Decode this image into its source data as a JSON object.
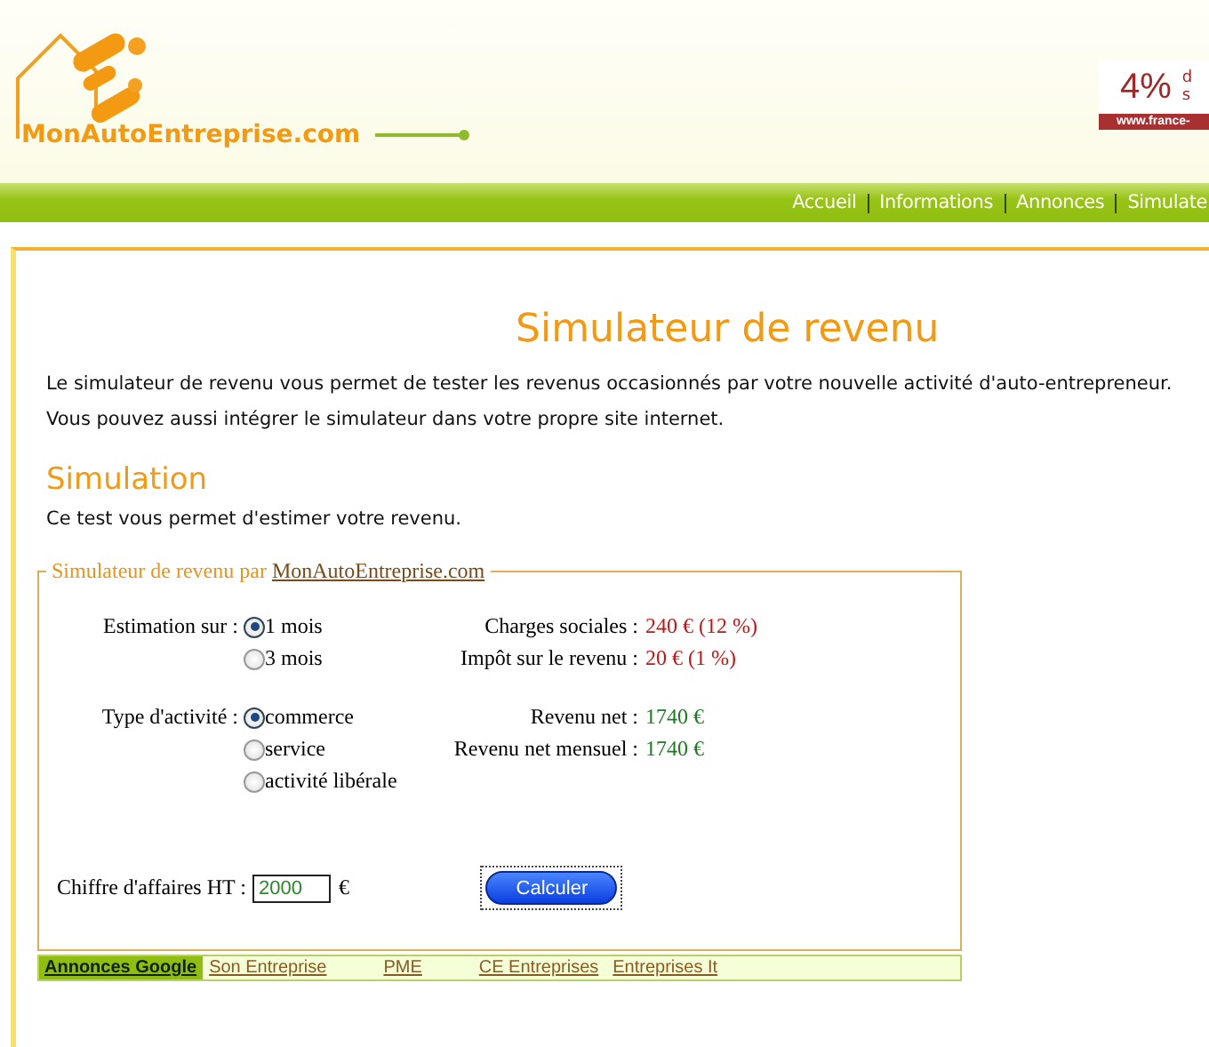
{
  "header": {
    "logo_text": "MonAutoEntreprise.com",
    "ad": {
      "percent": "4%",
      "line_1": "d",
      "line_2": "s",
      "url": "www.france-"
    }
  },
  "nav": [
    {
      "label": "Accueil"
    },
    {
      "label": "Informations"
    },
    {
      "label": "Annonces"
    },
    {
      "label": "Simulate"
    }
  ],
  "page": {
    "title": "Simulateur de revenu",
    "intro": [
      "Le simulateur de revenu vous permet de tester les revenus occasionnés par votre nouvelle activité d'auto-entrepreneur.",
      "Vous pouvez aussi intégrer le simulateur dans votre propre site internet."
    ],
    "section_title": "Simulation",
    "section_text": "Ce test vous permet d'estimer votre revenu."
  },
  "simulator": {
    "legend": "Simulateur de revenu par",
    "legend_link": "MonAutoEntreprise.com",
    "groups": [
      {
        "label": "Estimation sur :",
        "options": [
          {
            "label": "1 mois",
            "selected": true
          },
          {
            "label": "3 mois",
            "selected": false
          }
        ]
      },
      {
        "label": "Type d'activité :",
        "options": [
          {
            "label": "commerce",
            "selected": true
          },
          {
            "label": "service",
            "selected": false
          },
          {
            "label": "activité libérale",
            "selected": false
          }
        ]
      }
    ],
    "results": [
      [
        {
          "label": "Charges sociales :",
          "value": "240 € (12 %)",
          "kind": "cost"
        },
        {
          "label": "Impôt sur le revenu :",
          "value": "20 € (1 %)",
          "kind": "cost"
        }
      ],
      [
        {
          "label": "Revenu net :",
          "value": "1740 €",
          "kind": "income"
        },
        {
          "label": "Revenu net mensuel :",
          "value": "1740 €",
          "kind": "income"
        }
      ]
    ],
    "revenue_label": "Chiffre d'affaires HT :",
    "revenue_value": "2000",
    "currency": "€",
    "button": "Calculer"
  },
  "ads": {
    "title": "Annonces Google",
    "links": [
      "Son Entreprise",
      "PME",
      "CE Entreprises",
      "Entreprises It"
    ]
  }
}
